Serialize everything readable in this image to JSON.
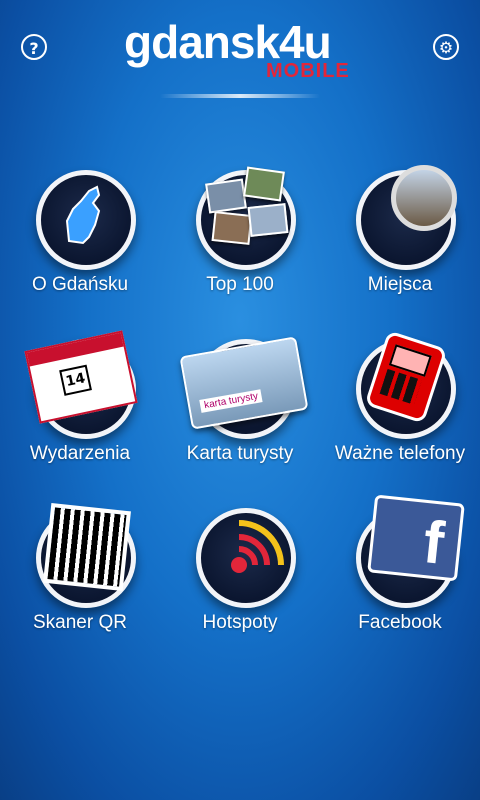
{
  "header": {
    "help_icon": "question-mark-icon",
    "help_glyph": "?",
    "settings_icon": "gear-icon",
    "settings_glyph": "⚙",
    "logo": {
      "main": "gdansk4u",
      "sub": "MOBILE"
    }
  },
  "menu": [
    {
      "label": "O Gdańsku",
      "icon": "gdansk-info-icon"
    },
    {
      "label": "Top 100",
      "icon": "photos-icon"
    },
    {
      "label": "Miejsca",
      "icon": "places-magnifier-icon"
    },
    {
      "label": "Wydarzenia",
      "icon": "calendar-icon",
      "day": "14"
    },
    {
      "label": "Karta turysty",
      "icon": "tourist-card-icon",
      "card_text": "karta turysty"
    },
    {
      "label": "Ważne telefony",
      "icon": "phone-icon"
    },
    {
      "label": "Skaner QR",
      "icon": "qr-code-icon"
    },
    {
      "label": "Hotspoty",
      "icon": "wifi-hotspot-icon"
    },
    {
      "label": "Facebook",
      "icon": "facebook-icon",
      "glyph": "f"
    }
  ],
  "colors": {
    "accent_red": "#e2263a",
    "background_blue": "#1470c8",
    "facebook_blue": "#3b5998"
  }
}
